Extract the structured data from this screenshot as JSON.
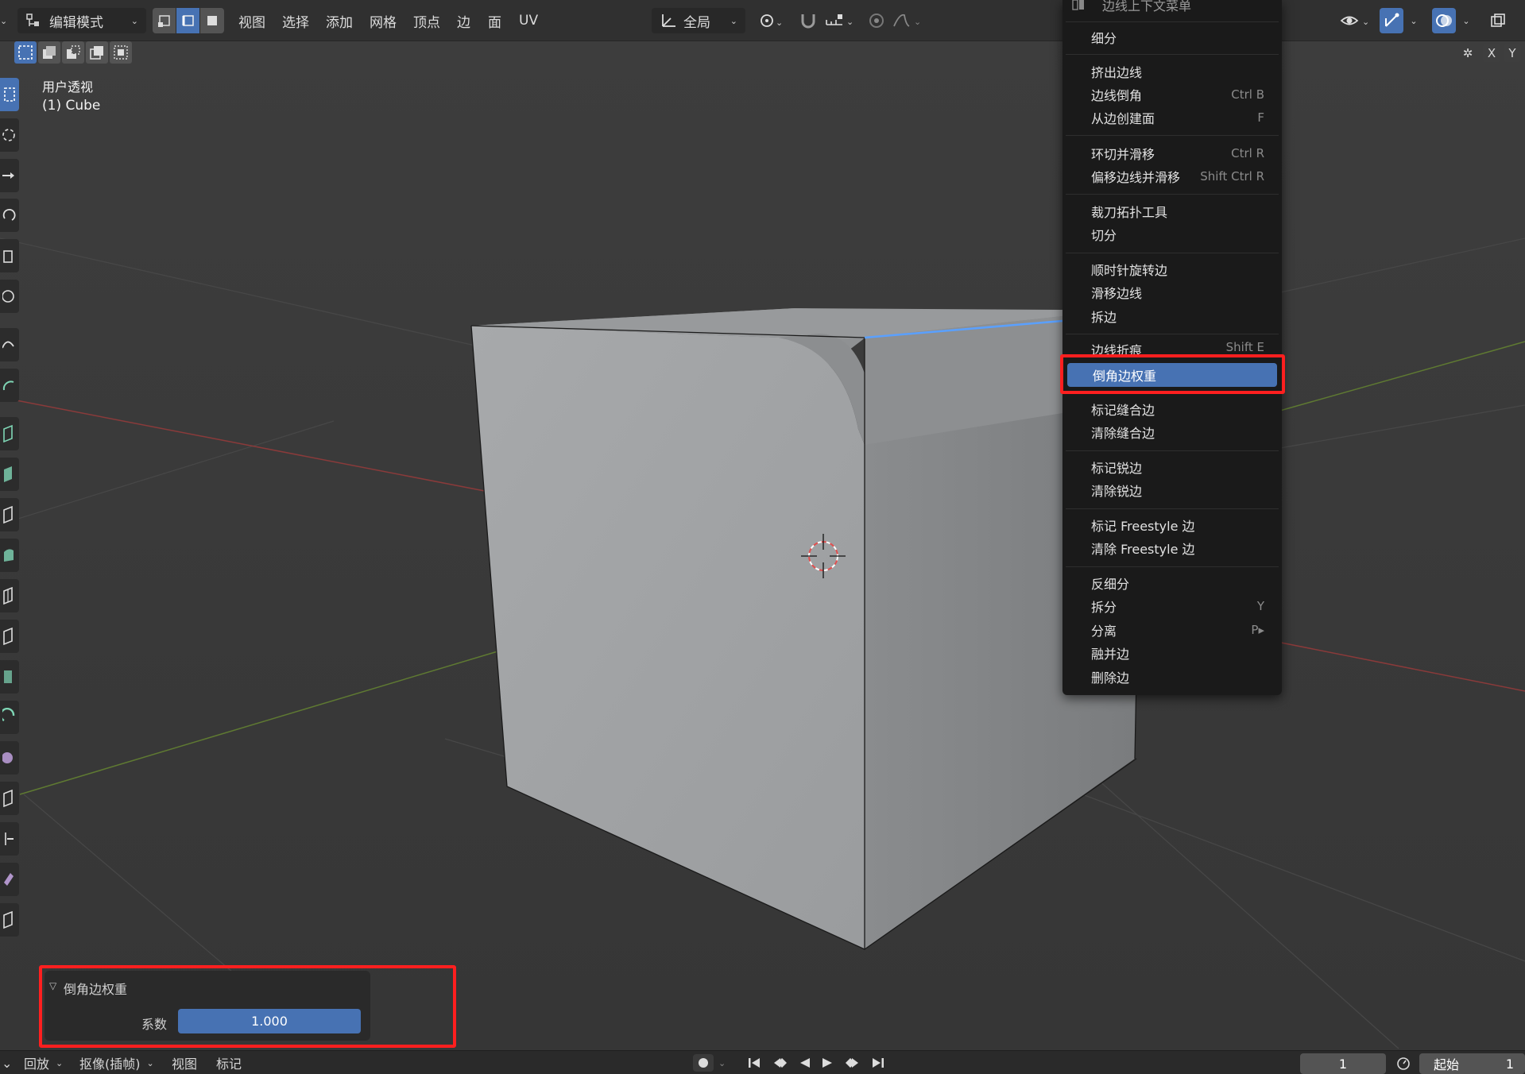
{
  "header": {
    "mode": "编辑模式",
    "menus": [
      "视图",
      "选择",
      "添加",
      "网格",
      "顶点",
      "边",
      "面",
      "UV"
    ],
    "transform_orientation": "全局"
  },
  "viewport": {
    "view_name": "用户透视",
    "object_name": "(1) Cube",
    "axis_labels": [
      "X",
      "Y"
    ]
  },
  "context_menu": {
    "title": "边线上下文菜单",
    "groups": [
      [
        {
          "label": "细分",
          "shortcut": ""
        }
      ],
      [
        {
          "label": "挤出边线",
          "shortcut": ""
        },
        {
          "label": "边线倒角",
          "shortcut": "Ctrl B"
        },
        {
          "label": "从边创建面",
          "shortcut": "F"
        }
      ],
      [
        {
          "label": "环切并滑移",
          "shortcut": "Ctrl R"
        },
        {
          "label": "偏移边线并滑移",
          "shortcut": "Shift Ctrl R"
        }
      ],
      [
        {
          "label": "裁刀拓扑工具",
          "shortcut": ""
        },
        {
          "label": "切分",
          "shortcut": ""
        }
      ],
      [
        {
          "label": "顺时针旋转边",
          "shortcut": ""
        },
        {
          "label": "滑移边线",
          "shortcut": ""
        },
        {
          "label": "拆边",
          "shortcut": ""
        }
      ],
      [
        {
          "label": "边线折痕",
          "shortcut": "Shift E"
        },
        {
          "label": "倒角边权重",
          "shortcut": ""
        }
      ],
      [
        {
          "label": "标记缝合边",
          "shortcut": ""
        },
        {
          "label": "清除缝合边",
          "shortcut": ""
        }
      ],
      [
        {
          "label": "标记锐边",
          "shortcut": ""
        },
        {
          "label": "清除锐边",
          "shortcut": ""
        }
      ],
      [
        {
          "label": "标记 Freestyle 边",
          "shortcut": ""
        },
        {
          "label": "清除 Freestyle 边",
          "shortcut": ""
        }
      ],
      [
        {
          "label": "反细分",
          "shortcut": ""
        },
        {
          "label": "拆分",
          "shortcut": "Y"
        },
        {
          "label": "分离",
          "shortcut": "P▸"
        },
        {
          "label": "融并边",
          "shortcut": ""
        },
        {
          "label": "删除边",
          "shortcut": ""
        }
      ]
    ],
    "highlighted": "倒角边权重"
  },
  "operator_panel": {
    "title": "倒角边权重",
    "field_label": "系数",
    "field_value": "1.000"
  },
  "timeline": {
    "playback": "回放",
    "keying": "抠像(插帧)",
    "view": "视图",
    "marker": "标记",
    "current_frame": "1",
    "start_label": "起始",
    "start_value": "1"
  },
  "colors": {
    "accent": "#4772b3",
    "highlight_box": "#ff1f1f",
    "selected_edge": "#5aa0ff"
  }
}
